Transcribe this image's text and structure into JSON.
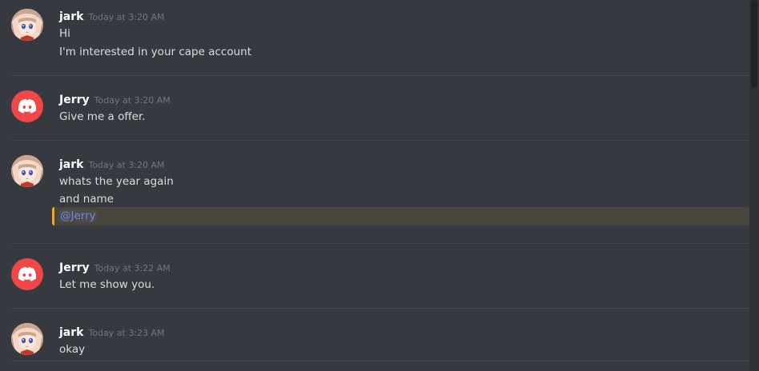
{
  "messages": [
    {
      "author": "jark",
      "timestamp": "Today at 3:20 AM",
      "avatar_icon": "anime-girl-avatar-icon",
      "lines": [
        "Hi",
        "I'm interested in your cape account"
      ]
    },
    {
      "author": "Jerry",
      "timestamp": "Today at 3:20 AM",
      "avatar_icon": "discord-logo-icon",
      "lines": [
        "Give me a offer."
      ]
    },
    {
      "author": "jark",
      "timestamp": "Today at 3:20 AM",
      "avatar_icon": "anime-girl-avatar-icon",
      "lines": [
        "whats the year again",
        "and name"
      ],
      "mention": "@Jerry"
    },
    {
      "author": "Jerry",
      "timestamp": "Today at 3:22 AM",
      "avatar_icon": "discord-logo-icon",
      "lines": [
        "Let me show you."
      ]
    },
    {
      "author": "jark",
      "timestamp": "Today at 3:23 AM",
      "avatar_icon": "anime-girl-avatar-icon",
      "lines": [
        "okay"
      ]
    }
  ],
  "colors": {
    "background": "#36393f",
    "username": "#ffffff",
    "timestamp": "#72767d",
    "text": "#dcddde",
    "mention_text": "#7289da",
    "mention_highlight": "#49443c",
    "mention_bar": "#faa61a",
    "discord_avatar": "#f04747"
  }
}
